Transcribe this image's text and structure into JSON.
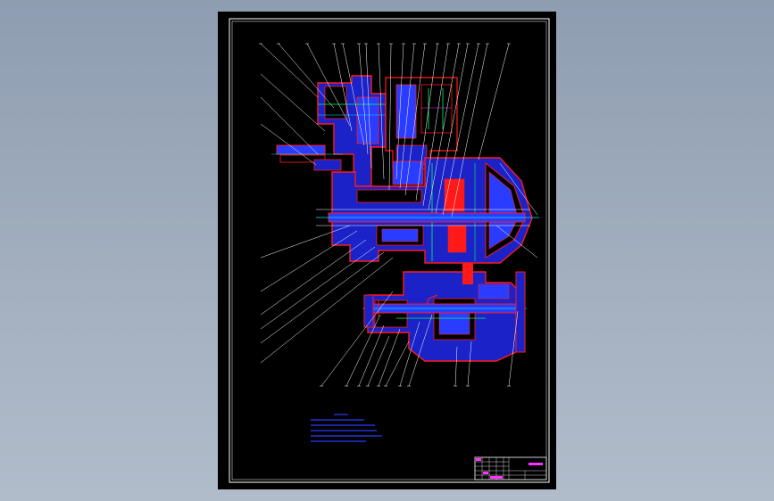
{
  "viewport": {
    "background_top": "#8e9db1",
    "background_bottom": "#b1bccb"
  },
  "drawing": {
    "sheet_color": "#000000",
    "frame_color": "#ffffff",
    "line_colors": {
      "outline": "#ff1a1a",
      "hatch": "#2a3cff",
      "center": "#00e5ff",
      "dimension": "#00ff66",
      "leader": "#ffffff",
      "magenta": "#ff33ff"
    },
    "icons": [
      "gearbox-section-drawing",
      "title-block",
      "technical-notes"
    ],
    "technical_notes": {
      "heading": "",
      "lines": [
        "",
        "",
        "",
        "",
        ""
      ]
    },
    "title_block": {
      "name": "",
      "drawing_number": "",
      "scale": "",
      "sheet": ""
    }
  }
}
